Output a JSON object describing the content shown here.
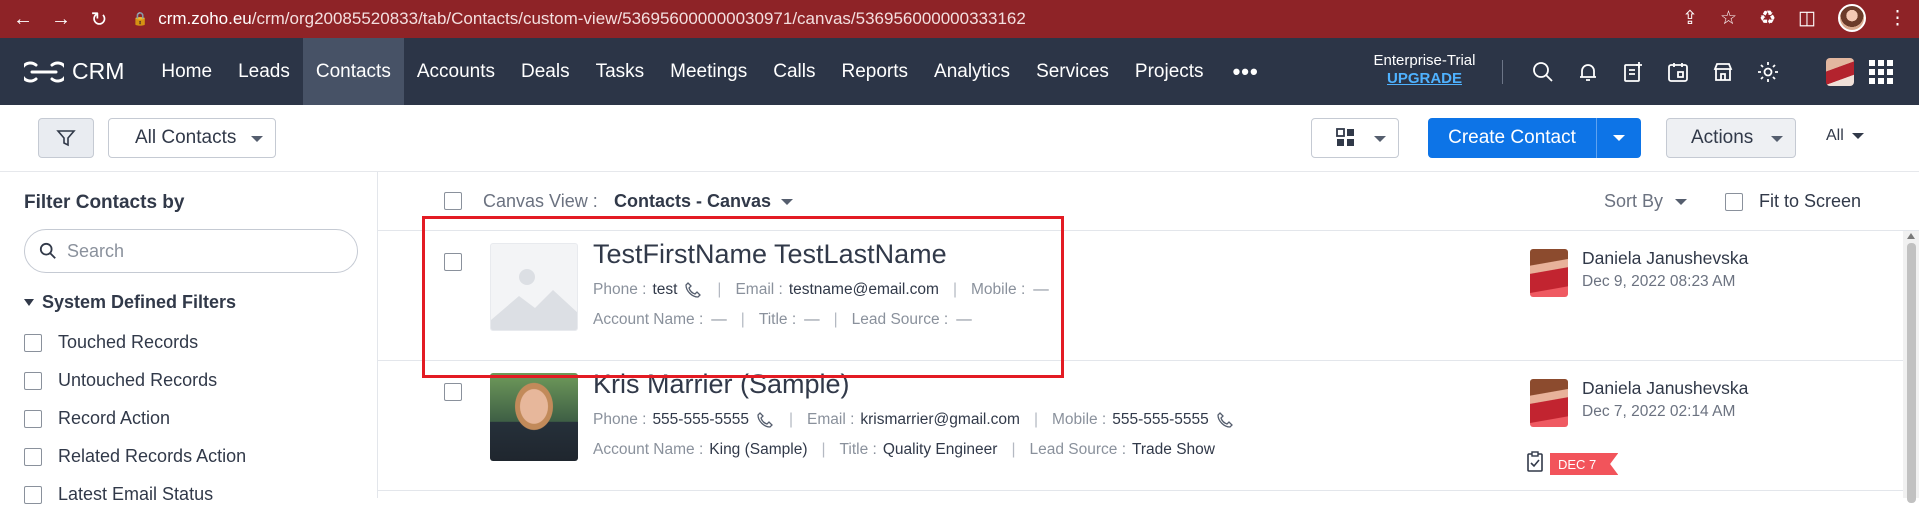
{
  "browser": {
    "url_prefix": "crm.zoho.eu",
    "url_path": "/crm/org20085520833/tab/Contacts/custom-view/536956000000030971/canvas/536956000000333162"
  },
  "nav": {
    "brand": "CRM",
    "items": [
      "Home",
      "Leads",
      "Contacts",
      "Accounts",
      "Deals",
      "Tasks",
      "Meetings",
      "Calls",
      "Reports",
      "Analytics",
      "Services",
      "Projects"
    ],
    "active": "Contacts",
    "more": "•••",
    "trial_label": "Enterprise-Trial",
    "upgrade_label": "UPGRADE"
  },
  "toolbar": {
    "view_name": "All Contacts",
    "create_label": "Create Contact",
    "actions_label": "Actions",
    "all_label": "All"
  },
  "sidebar": {
    "title": "Filter Contacts by",
    "search_placeholder": "Search",
    "section": "System Defined Filters",
    "filters": [
      "Touched Records",
      "Untouched Records",
      "Record Action",
      "Related Records Action",
      "Latest Email Status"
    ]
  },
  "main": {
    "canvas_label": "Canvas View :",
    "canvas_name": "Contacts - Canvas",
    "sort_label": "Sort By",
    "fit_label": "Fit to Screen"
  },
  "labels": {
    "phone": "Phone :",
    "email": "Email :",
    "mobile": "Mobile :",
    "account": "Account Name :",
    "title": "Title :",
    "lead_source": "Lead Source :"
  },
  "records": [
    {
      "name": "TestFirstName TestLastName",
      "phone": "test",
      "email": "testname@email.com",
      "mobile": "—",
      "account": "—",
      "title": "—",
      "lead_source": "—",
      "owner": "Daniela Janushevska",
      "date": "Dec 9, 2022 08:23 AM"
    },
    {
      "name": "Kris Marrier (Sample)",
      "phone": "555-555-5555",
      "email": "krismarrier@gmail.com",
      "mobile": "555-555-5555",
      "account": "King (Sample)",
      "title": "Quality Engineer",
      "lead_source": "Trade Show",
      "owner": "Daniela Janushevska",
      "date": "Dec 7, 2022 02:14 AM",
      "badge": "DEC 7"
    }
  ],
  "colors": {
    "browser_bar": "#8e2327",
    "nav_bg": "#2c3547",
    "primary": "#0d74e7",
    "highlight": "#e31b23"
  }
}
